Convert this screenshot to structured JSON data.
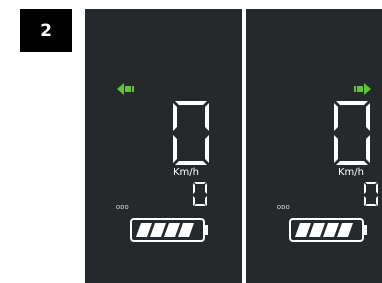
{
  "badge": {
    "number": "2"
  },
  "colors": {
    "panel_bg": "#25292b",
    "indicator_green": "#5fc43a",
    "segment_white": "#ffffff"
  },
  "displays": [
    {
      "turn_signal": "left",
      "turn_icon": "arrow-left-icon",
      "speed": "0",
      "unit": "Km/h",
      "distance": "0",
      "odo_label": "ODO",
      "battery_level": 1.0
    },
    {
      "turn_signal": "right",
      "turn_icon": "arrow-right-icon",
      "speed": "0",
      "unit": "Km/h",
      "distance": "0",
      "odo_label": "ODO",
      "battery_level": 1.0
    }
  ]
}
